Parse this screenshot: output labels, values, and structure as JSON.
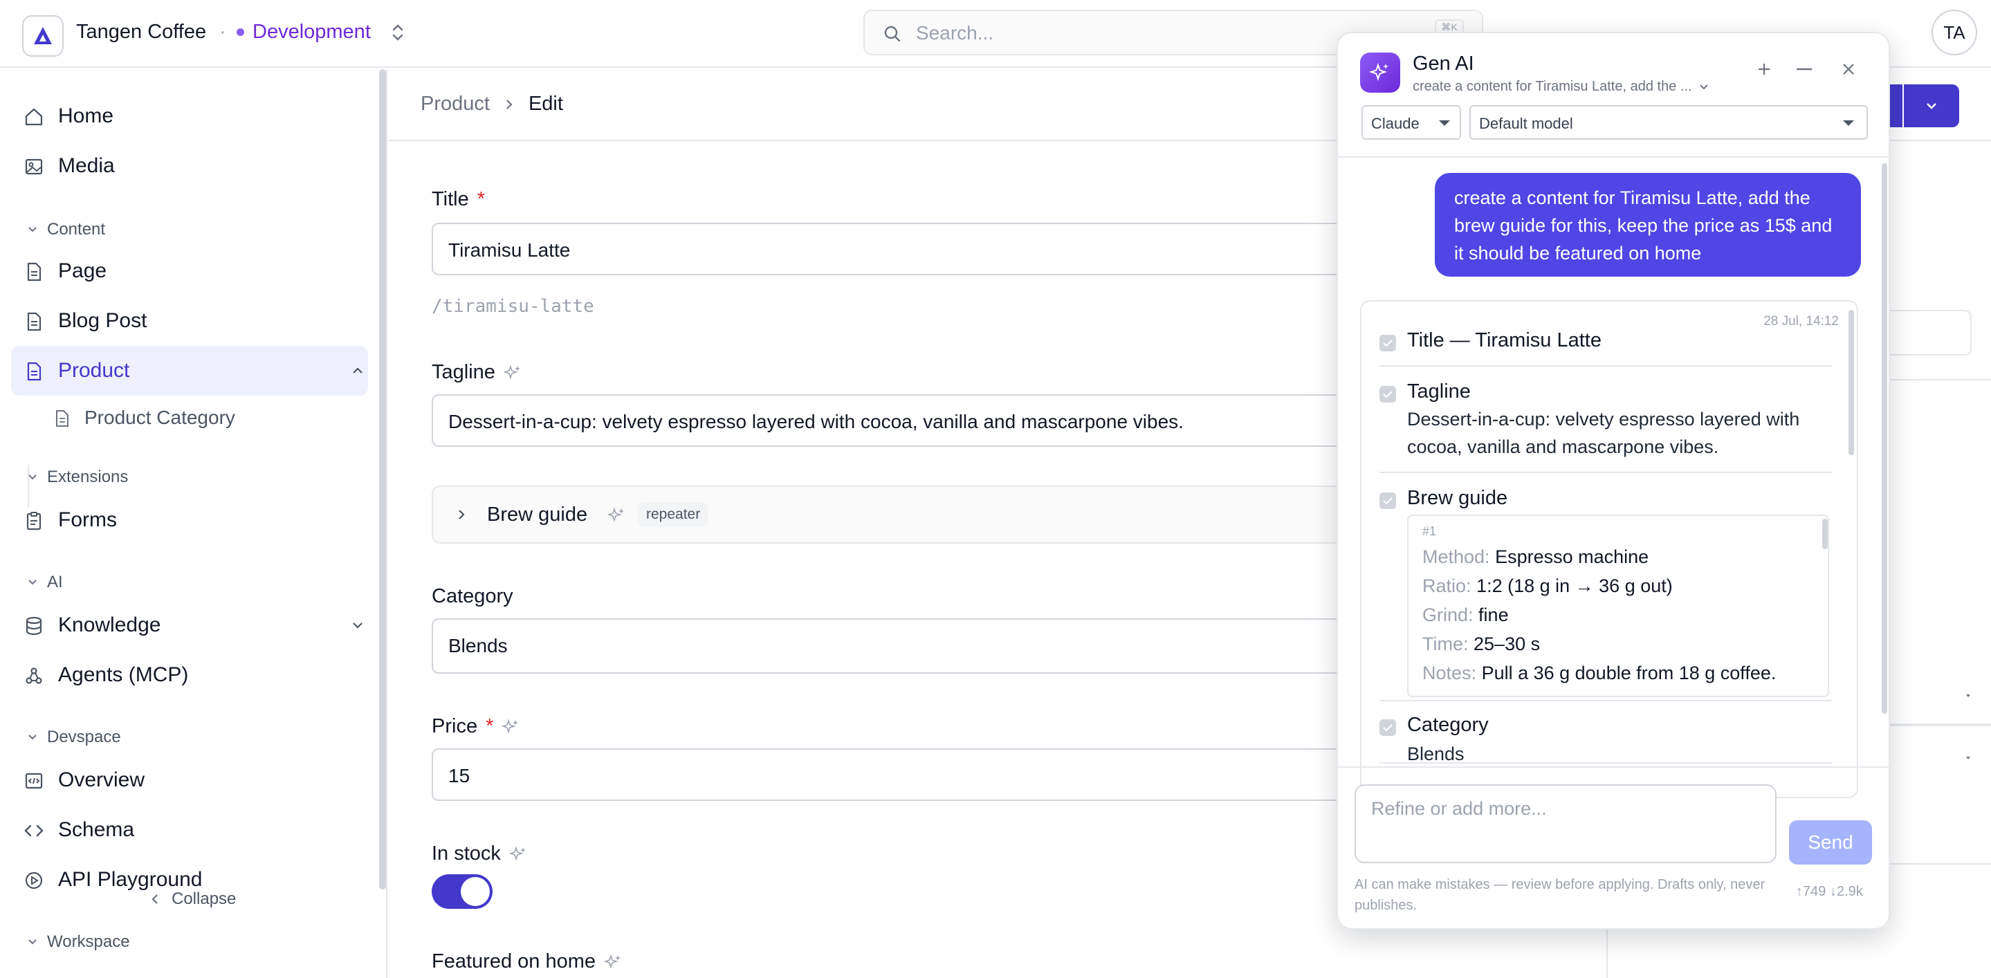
{
  "app": {
    "brand": "Tangen Coffee",
    "separator": "·",
    "environment": "Development",
    "search_placeholder": "Search...",
    "search_shortcut": "⌘K",
    "avatar_initials": "TA"
  },
  "sidebar": {
    "items": [
      {
        "label": "Home",
        "icon": "home-icon"
      },
      {
        "label": "Media",
        "icon": "image-icon"
      }
    ],
    "sections": {
      "content": "Content",
      "extensions": "Extensions",
      "ai": "AI",
      "devspace": "Devspace",
      "workspace": "Workspace"
    },
    "content_items": [
      "Page",
      "Blog Post",
      "Product"
    ],
    "product_sub": "Product Category",
    "extension_items": [
      "Forms"
    ],
    "ai_items": [
      "Knowledge",
      "Agents (MCP)"
    ],
    "devspace_items": [
      "Overview",
      "Schema",
      "API Playground"
    ],
    "collapse_label": "Collapse",
    "active_item": "Product"
  },
  "breadcrumb": {
    "root": "Product",
    "current": "Edit"
  },
  "form": {
    "title_label": "Title",
    "title_value": "Tiramisu Latte",
    "slug": "/tiramisu-latte",
    "tagline_label": "Tagline",
    "tagline_value": "Dessert-in-a-cup: velvety espresso layered with cocoa, vanilla and mascarpone vibes.",
    "brew_label": "Brew guide",
    "brew_tag": "repeater",
    "category_label": "Category",
    "category_value": "Blends",
    "price_label": "Price",
    "price_value": "15",
    "in_stock_label": "In stock",
    "in_stock": true,
    "featured_label": "Featured on home",
    "required_mark": "*"
  },
  "genai": {
    "title": "Gen AI",
    "subtitle": "create a content for Tiramisu Latte, add the ...",
    "provider": "Claude",
    "model": "Default model",
    "user_message": "create a content for Tiramisu Latte, add the brew guide for this, keep the price as 15$ and it should be featured on home",
    "timestamp": "28 Jul, 14:12",
    "title_suggestion": "Title — Tiramisu Latte",
    "tagline_label": "Tagline",
    "tagline_value": "Dessert-in-a-cup: velvety espresso layered with cocoa, vanilla and mascarpone vibes.",
    "brew_label": "Brew guide",
    "brew_index": "#1",
    "brew_fields": [
      {
        "key": "Method:",
        "value": "Espresso machine"
      },
      {
        "key": "Ratio:",
        "value": "1:2 (18 g in → 36 g out)"
      },
      {
        "key": "Grind:",
        "value": "fine"
      },
      {
        "key": "Time:",
        "value": "25–30 s"
      },
      {
        "key": "Notes:",
        "value": "Pull a 36 g double from 18 g coffee."
      }
    ],
    "category_label": "Category",
    "category_value": "Blends",
    "input_placeholder": "Refine or add more...",
    "send_label": "Send",
    "disclaimer": "AI can make mistakes — review before applying. Drafts only, never publishes.",
    "tokens": "↑749 ↓2.9k"
  },
  "colors": {
    "accent": "#4338ca",
    "environment": "#6d28d9",
    "required": "#dc2626",
    "bubble": "#4f46e5",
    "send_disabled": "#a5b4fc"
  }
}
